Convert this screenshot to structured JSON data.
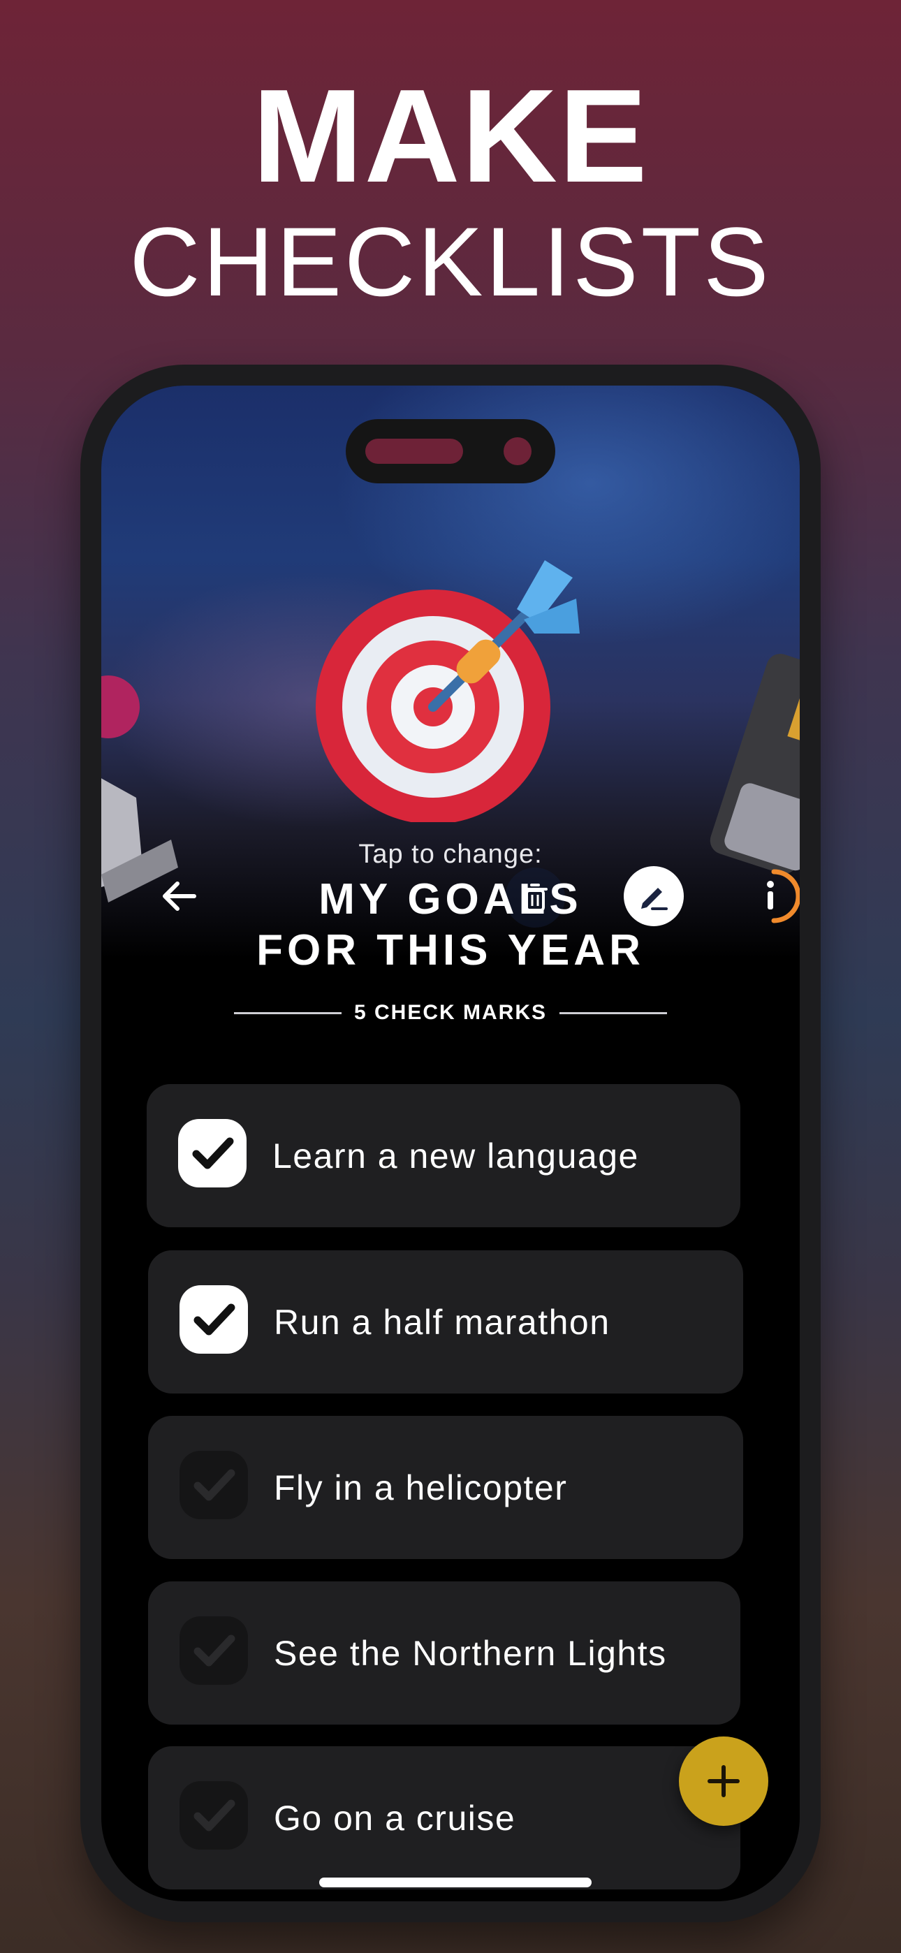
{
  "promo": {
    "headline_top": "MAKE",
    "headline_bottom": "CHECKLISTS"
  },
  "toolbar": {
    "back_icon": "arrow-left-icon",
    "trash_icon": "trash-icon",
    "edit_icon": "pencil-icon",
    "info_icon": "info-icon"
  },
  "checklist": {
    "emoji_icon": "dart-target-icon",
    "tap_label": "Tap to change:",
    "title_line1": "MY GOALS",
    "title_line2": "FOR THIS YEAR",
    "count_label": "5 CHECK MARKS",
    "items": [
      {
        "label": "Learn a new language",
        "checked": true
      },
      {
        "label": "Run a half marathon",
        "checked": true
      },
      {
        "label": "Fly in a helicopter",
        "checked": false
      },
      {
        "label": "See the Northern Lights",
        "checked": false
      },
      {
        "label": "Go on a cruise",
        "checked": false
      }
    ]
  },
  "fab": {
    "icon": "plus-icon"
  },
  "colors": {
    "accent_yellow": "#caa21c",
    "info_ring_orange": "#f08a2c",
    "item_background": "#1f1f21",
    "background_top": "#6e2437"
  }
}
